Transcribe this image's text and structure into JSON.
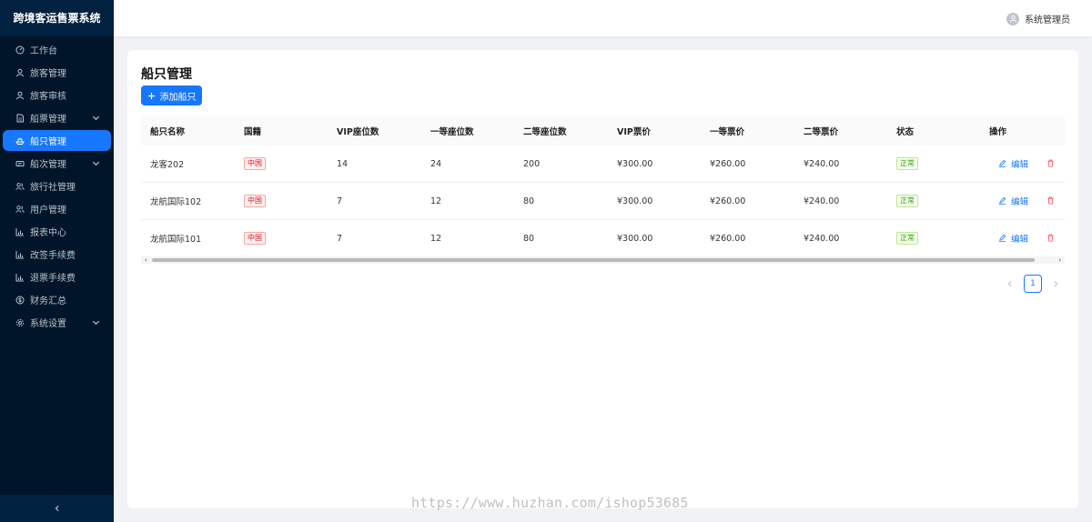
{
  "app": {
    "title": "跨境客运售票系统"
  },
  "user": {
    "name": "系统管理员"
  },
  "sidebar": {
    "items": [
      {
        "label": "工作台",
        "icon": "dashboard-icon",
        "has_children": false,
        "active": false
      },
      {
        "label": "旅客管理",
        "icon": "user-icon",
        "has_children": false,
        "active": false
      },
      {
        "label": "旅客审核",
        "icon": "user-icon",
        "has_children": false,
        "active": false
      },
      {
        "label": "船票管理",
        "icon": "document-icon",
        "has_children": true,
        "active": false
      },
      {
        "label": "船只管理",
        "icon": "ship-icon",
        "has_children": false,
        "active": true
      },
      {
        "label": "船次管理",
        "icon": "ticket-icon",
        "has_children": true,
        "active": false
      },
      {
        "label": "旅行社管理",
        "icon": "team-icon",
        "has_children": false,
        "active": false
      },
      {
        "label": "用户管理",
        "icon": "team-icon",
        "has_children": false,
        "active": false
      },
      {
        "label": "报表中心",
        "icon": "bar-chart-icon",
        "has_children": false,
        "active": false
      },
      {
        "label": "改签手续费",
        "icon": "bar-chart-icon",
        "has_children": false,
        "active": false
      },
      {
        "label": "退票手续费",
        "icon": "bar-chart-icon",
        "has_children": false,
        "active": false
      },
      {
        "label": "财务汇总",
        "icon": "dollar-icon",
        "has_children": false,
        "active": false
      },
      {
        "label": "系统设置",
        "icon": "gear-icon",
        "has_children": true,
        "active": false
      }
    ]
  },
  "page": {
    "title": "船只管理",
    "add_button": "添加船只"
  },
  "table": {
    "headers": {
      "name": "船只名称",
      "nationality": "国籍",
      "vip_seats": "VIP座位数",
      "first_seats": "一等座位数",
      "second_seats": "二等座位数",
      "vip_price": "VIP票价",
      "first_price": "一等票价",
      "second_price": "二等票价",
      "status": "状态",
      "ops": "操作"
    },
    "rows": [
      {
        "name": "龙客202",
        "nationality": "中国",
        "vip_seats": "14",
        "first_seats": "24",
        "second_seats": "200",
        "vip_price": "¥300.00",
        "first_price": "¥260.00",
        "second_price": "¥240.00",
        "status": "正常"
      },
      {
        "name": "龙航国际102",
        "nationality": "中国",
        "vip_seats": "7",
        "first_seats": "12",
        "second_seats": "80",
        "vip_price": "¥300.00",
        "first_price": "¥260.00",
        "second_price": "¥240.00",
        "status": "正常"
      },
      {
        "name": "龙航国际101",
        "nationality": "中国",
        "vip_seats": "7",
        "first_seats": "12",
        "second_seats": "80",
        "vip_price": "¥300.00",
        "first_price": "¥260.00",
        "second_price": "¥240.00",
        "status": "正常"
      }
    ],
    "edit_label": "编辑"
  },
  "pagination": {
    "current": "1"
  },
  "watermark": "https://www.huzhan.com/ishop53685",
  "colors": {
    "primary": "#1677ff",
    "sidebar_bg": "#001529",
    "danger": "#ff4d4f"
  }
}
